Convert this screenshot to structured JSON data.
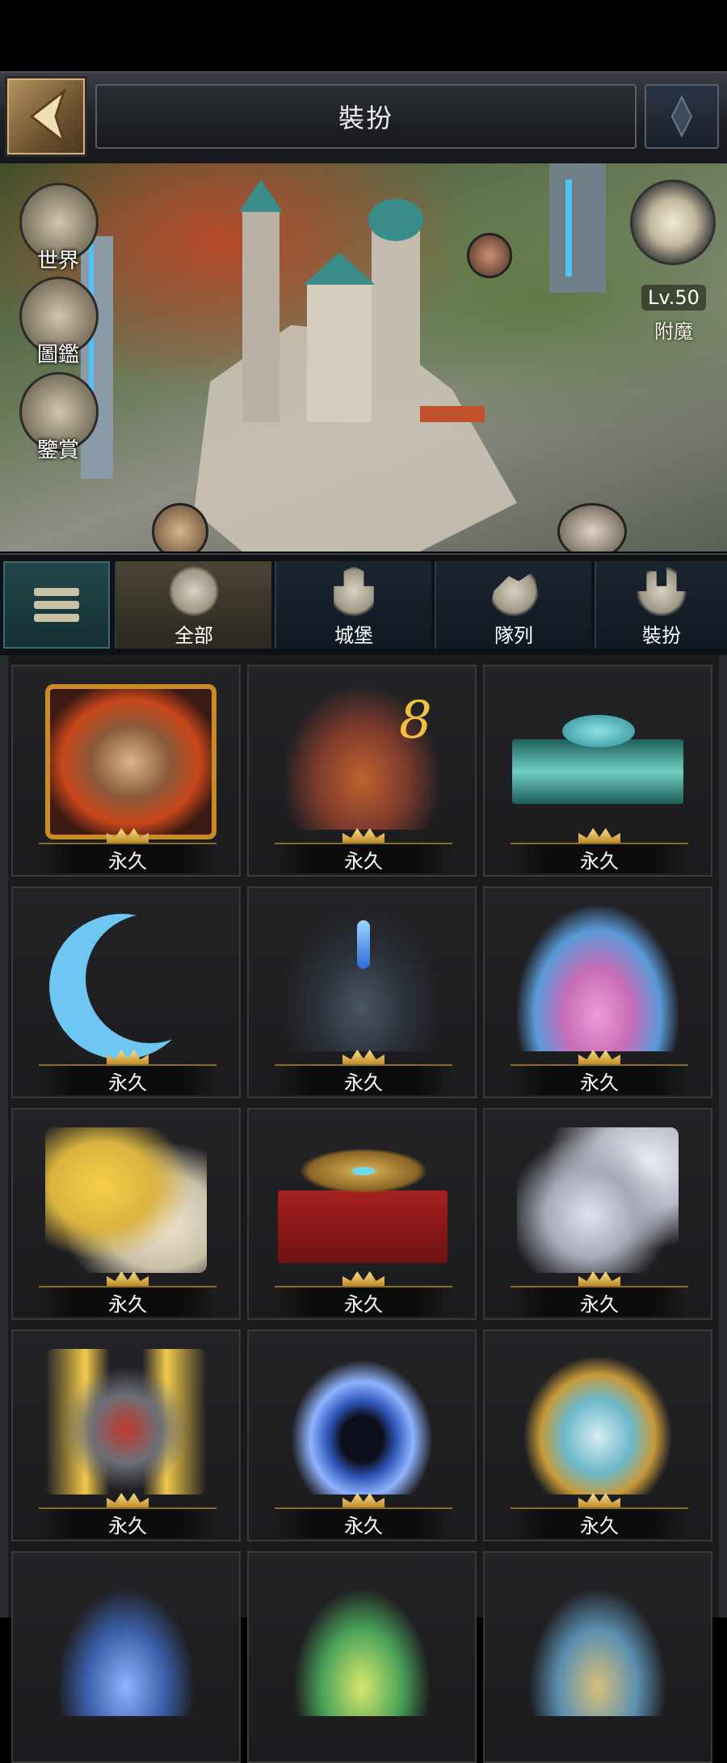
{
  "header": {
    "title": "裝扮"
  },
  "scene": {
    "side_buttons": [
      {
        "label": "世界",
        "icon": "world-map-icon"
      },
      {
        "label": "圖鑑",
        "icon": "scroll-icon"
      },
      {
        "label": "鑒賞",
        "icon": "appraise-icon"
      }
    ],
    "enchant": {
      "level": "Lv.50",
      "label": "附魔"
    }
  },
  "tabs": [
    {
      "label": "全部",
      "icon": "bag-icon",
      "active": true
    },
    {
      "label": "城堡",
      "icon": "castle-icon",
      "active": false
    },
    {
      "label": "隊列",
      "icon": "cavalry-icon",
      "active": false
    },
    {
      "label": "裝扮",
      "icon": "buildings-icon",
      "active": false
    }
  ],
  "items": [
    {
      "label": "永久",
      "art": "portrait-frame",
      "color": "#c9471b"
    },
    {
      "label": "永久",
      "art": "castle-skin-8",
      "color": "#7c3a2c"
    },
    {
      "label": "永久",
      "art": "dragon-nameplate",
      "color": "#2e6b6b"
    },
    {
      "label": "永久",
      "art": "crescent-moon",
      "color": "#5fb6e6"
    },
    {
      "label": "永久",
      "art": "dark-castle",
      "color": "#3d5d7a"
    },
    {
      "label": "永久",
      "art": "candy-castle",
      "color": "#c76db8"
    },
    {
      "label": "永久",
      "art": "lion-mount",
      "color": "#d9b440"
    },
    {
      "label": "永久",
      "art": "red-nameplate",
      "color": "#8c1d1d"
    },
    {
      "label": "永久",
      "art": "pegasus",
      "color": "#a7abb8"
    },
    {
      "label": "永久",
      "art": "winged-knight",
      "color": "#c29a3c"
    },
    {
      "label": "永久",
      "art": "blue-portal",
      "color": "#2f56b8"
    },
    {
      "label": "永久",
      "art": "ice-castle",
      "color": "#6bb8c9"
    },
    {
      "label": "",
      "art": "partial-item",
      "color": "#3b5ea8"
    },
    {
      "label": "",
      "art": "partial-item",
      "color": "#4aa35a"
    },
    {
      "label": "",
      "art": "partial-item",
      "color": "#5b8fb0"
    }
  ]
}
